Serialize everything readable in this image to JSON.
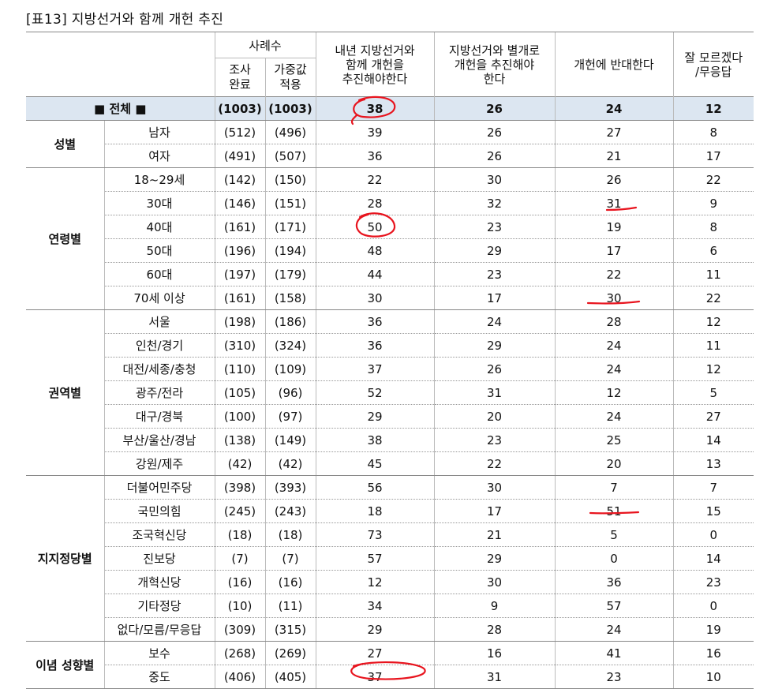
{
  "title": "[표13] 지방선거와 함께 개헌 추진",
  "header": {
    "cases": "사례수",
    "surveyed": [
      "조사",
      "완료"
    ],
    "weighted": [
      "가중값",
      "적용"
    ],
    "col1": [
      "내년 지방선거와",
      "함께 개헌을",
      "추진해야한다"
    ],
    "col2": [
      "지방선거와 별개로",
      "개헌을 추진해야",
      "한다"
    ],
    "col3": "개헌에 반대한다",
    "col4": [
      "잘 모르겠다",
      "/무응답"
    ]
  },
  "total": {
    "label": "■ 전체 ■",
    "n": "(1003)",
    "w": "(1003)",
    "v": [
      "38",
      "26",
      "24",
      "12"
    ]
  },
  "groups": [
    {
      "name": "성별",
      "rows": [
        {
          "label": "남자",
          "n": "(512)",
          "w": "(496)",
          "v": [
            "39",
            "26",
            "27",
            "8"
          ]
        },
        {
          "label": "여자",
          "n": "(491)",
          "w": "(507)",
          "v": [
            "36",
            "26",
            "21",
            "17"
          ]
        }
      ]
    },
    {
      "name": "연령별",
      "rows": [
        {
          "label": "18~29세",
          "n": "(142)",
          "w": "(150)",
          "v": [
            "22",
            "30",
            "26",
            "22"
          ]
        },
        {
          "label": "30대",
          "n": "(146)",
          "w": "(151)",
          "v": [
            "28",
            "32",
            "31",
            "9"
          ]
        },
        {
          "label": "40대",
          "n": "(161)",
          "w": "(171)",
          "v": [
            "50",
            "23",
            "19",
            "8"
          ]
        },
        {
          "label": "50대",
          "n": "(196)",
          "w": "(194)",
          "v": [
            "48",
            "29",
            "17",
            "6"
          ]
        },
        {
          "label": "60대",
          "n": "(197)",
          "w": "(179)",
          "v": [
            "44",
            "23",
            "22",
            "11"
          ]
        },
        {
          "label": "70세 이상",
          "n": "(161)",
          "w": "(158)",
          "v": [
            "30",
            "17",
            "30",
            "22"
          ]
        }
      ]
    },
    {
      "name": "권역별",
      "rows": [
        {
          "label": "서울",
          "n": "(198)",
          "w": "(186)",
          "v": [
            "36",
            "24",
            "28",
            "12"
          ]
        },
        {
          "label": "인천/경기",
          "n": "(310)",
          "w": "(324)",
          "v": [
            "36",
            "29",
            "24",
            "11"
          ]
        },
        {
          "label": "대전/세종/충청",
          "n": "(110)",
          "w": "(109)",
          "v": [
            "37",
            "26",
            "24",
            "12"
          ]
        },
        {
          "label": "광주/전라",
          "n": "(105)",
          "w": "(96)",
          "v": [
            "52",
            "31",
            "12",
            "5"
          ]
        },
        {
          "label": "대구/경북",
          "n": "(100)",
          "w": "(97)",
          "v": [
            "29",
            "20",
            "24",
            "27"
          ]
        },
        {
          "label": "부산/울산/경남",
          "n": "(138)",
          "w": "(149)",
          "v": [
            "38",
            "23",
            "25",
            "14"
          ]
        },
        {
          "label": "강원/제주",
          "n": "(42)",
          "w": "(42)",
          "v": [
            "45",
            "22",
            "20",
            "13"
          ]
        }
      ]
    },
    {
      "name": "지지정당별",
      "rows": [
        {
          "label": "더불어민주당",
          "n": "(398)",
          "w": "(393)",
          "v": [
            "56",
            "30",
            "7",
            "7"
          ]
        },
        {
          "label": "국민의힘",
          "n": "(245)",
          "w": "(243)",
          "v": [
            "18",
            "17",
            "51",
            "15"
          ]
        },
        {
          "label": "조국혁신당",
          "n": "(18)",
          "w": "(18)",
          "v": [
            "73",
            "21",
            "5",
            "0"
          ]
        },
        {
          "label": "진보당",
          "n": "(7)",
          "w": "(7)",
          "v": [
            "57",
            "29",
            "0",
            "14"
          ]
        },
        {
          "label": "개혁신당",
          "n": "(16)",
          "w": "(16)",
          "v": [
            "12",
            "30",
            "36",
            "23"
          ]
        },
        {
          "label": "기타정당",
          "n": "(10)",
          "w": "(11)",
          "v": [
            "34",
            "9",
            "57",
            "0"
          ]
        },
        {
          "label": "없다/모름/무응답",
          "n": "(309)",
          "w": "(315)",
          "v": [
            "29",
            "28",
            "24",
            "19"
          ]
        }
      ]
    },
    {
      "name": "이념 성향별",
      "rows": [
        {
          "label": "보수",
          "n": "(268)",
          "w": "(269)",
          "v": [
            "27",
            "16",
            "41",
            "16"
          ]
        },
        {
          "label": "중도",
          "n": "(406)",
          "w": "(405)",
          "v": [
            "37",
            "31",
            "23",
            "10"
          ]
        }
      ]
    }
  ],
  "annotation_color": "#e8141e"
}
